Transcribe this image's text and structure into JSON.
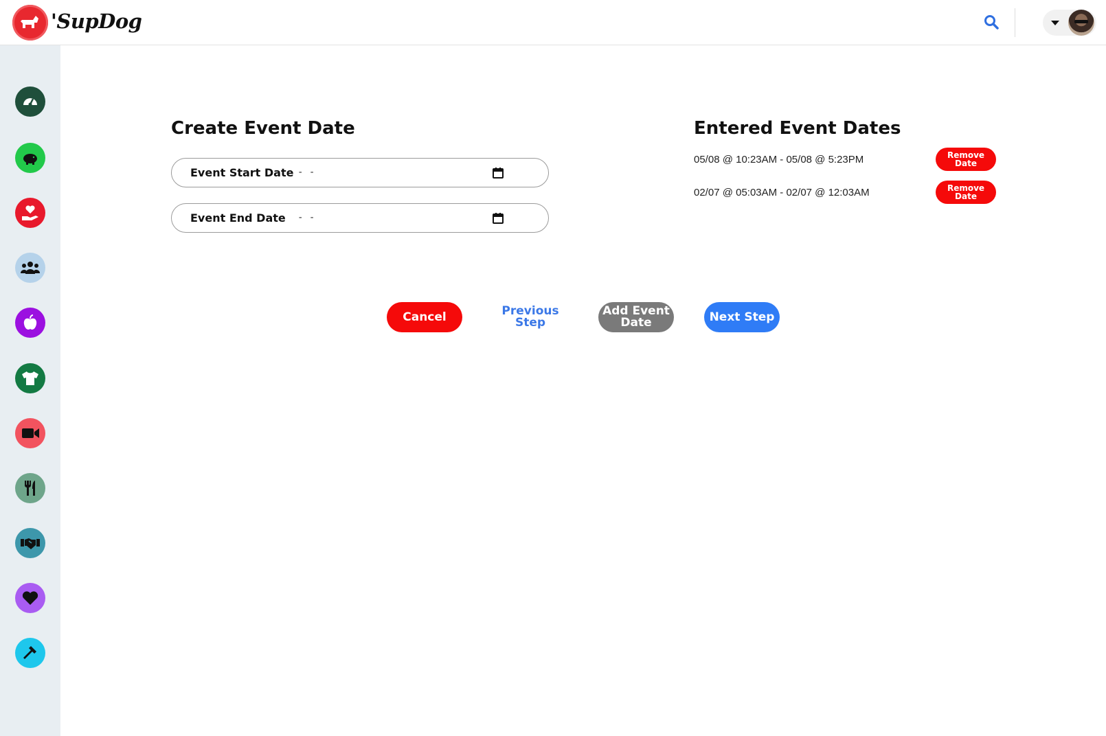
{
  "app": {
    "brand_name": "'SupDog"
  },
  "header": {
    "search_icon": "search-icon",
    "profile_caret_icon": "caret-down-icon"
  },
  "sidebar": {
    "items": [
      {
        "icon": "dashboard-gauge-icon",
        "color": "#1f4f3b"
      },
      {
        "icon": "piggy-bank-icon",
        "color": "#22c94a"
      },
      {
        "icon": "hand-holding-heart-icon",
        "color": "#e8192c"
      },
      {
        "icon": "users-group-icon",
        "color": "#b5d2ea"
      },
      {
        "icon": "apple-icon",
        "color": "#9b10e0"
      },
      {
        "icon": "tshirt-icon",
        "color": "#137a43"
      },
      {
        "icon": "video-camera-icon",
        "color": "#f2535f"
      },
      {
        "icon": "utensils-icon",
        "color": "#6ea58a"
      },
      {
        "icon": "handshake-icon",
        "color": "#3d97ab"
      },
      {
        "icon": "heart-icon",
        "color": "#a95cf2"
      },
      {
        "icon": "hammer-icon",
        "color": "#1ec7ec"
      }
    ]
  },
  "create": {
    "title": "Create Event Date",
    "start_label": "Event Start Date",
    "start_value": "- -",
    "end_label": "Event End Date",
    "end_value": "- -"
  },
  "entered": {
    "title": "Entered Event Dates",
    "dates": [
      {
        "text": "05/08 @ 10:23AM - 05/08 @ 5:23PM",
        "remove_label": "Remove Date"
      },
      {
        "text": "02/07 @ 05:03AM - 02/07 @ 12:03AM",
        "remove_label": "Remove Date"
      }
    ]
  },
  "actions": {
    "cancel": "Cancel",
    "previous": "Previous Step",
    "add": "Add Event Date",
    "next": "Next Step"
  },
  "colors": {
    "accent_red": "#f50a0a",
    "accent_blue": "#2f7cf6",
    "link_blue": "#3b78e7",
    "neutral_gray": "#7a7a7a",
    "sidebar_bg": "#e8eef2"
  }
}
